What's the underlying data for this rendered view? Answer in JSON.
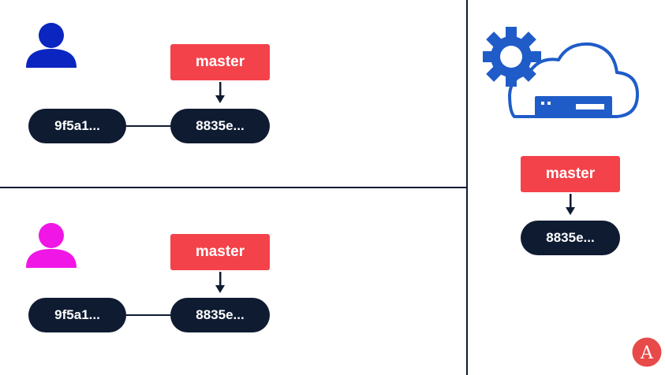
{
  "colors": {
    "commit_bg": "#0e1b31",
    "branch_bg": "#f4424a",
    "user1": "#0a25c0",
    "user2": "#f016e6",
    "cloud_blue": "#1f5cc8",
    "logo_red": "#e84a4a"
  },
  "top_panel": {
    "user_icon": "user-icon",
    "branch_label": "master",
    "commits": [
      "9f5a1...",
      "8835e..."
    ]
  },
  "bottom_panel": {
    "user_icon": "user-icon",
    "branch_label": "master",
    "commits": [
      "9f5a1...",
      "8835e..."
    ]
  },
  "remote_panel": {
    "server_icon": "cloud-server-gear-icon",
    "branch_label": "master",
    "commit": "8835e..."
  },
  "logo": {
    "icon": "a-logo-icon",
    "letter": "A"
  }
}
